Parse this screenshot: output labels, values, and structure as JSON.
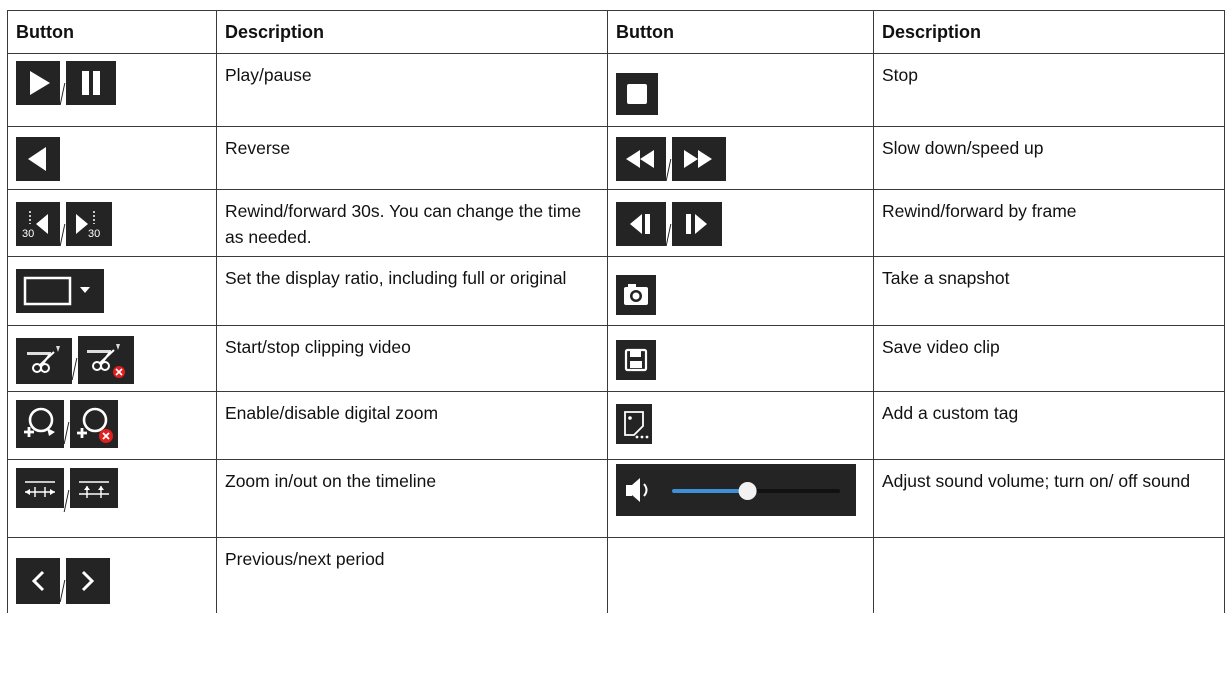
{
  "headers": {
    "button": "Button",
    "description": "Description",
    "button2": "Button",
    "description2": "Description"
  },
  "rows": [
    {
      "left_desc": "Play/pause",
      "right_desc": "Stop"
    },
    {
      "left_desc": "Reverse",
      "right_desc": "Slow down/speed up"
    },
    {
      "left_desc": "Rewind/forward 30s. You can change the time as needed.",
      "right_desc": "Rewind/forward by frame"
    },
    {
      "left_desc": "Set the display ratio, including full or original",
      "right_desc": "Take a snapshot"
    },
    {
      "left_desc": "Start/stop clipping video",
      "right_desc": "Save video clip"
    },
    {
      "left_desc": "Enable/disable digital zoom",
      "right_desc": "Add a custom tag"
    },
    {
      "left_desc": "Zoom in/out on the timeline",
      "right_desc": "Adjust sound volume; turn on/ off sound"
    },
    {
      "left_desc": "Previous/next period",
      "right_desc": ""
    }
  ],
  "icon_labels": {
    "rewind": "30",
    "forward": "30"
  },
  "volume": {
    "level": 0.45
  },
  "colors": {
    "icon_bg": "#242424",
    "icon_fg": "#ffffff",
    "accent": "#3d8fd6",
    "stop_red": "#e02020"
  }
}
